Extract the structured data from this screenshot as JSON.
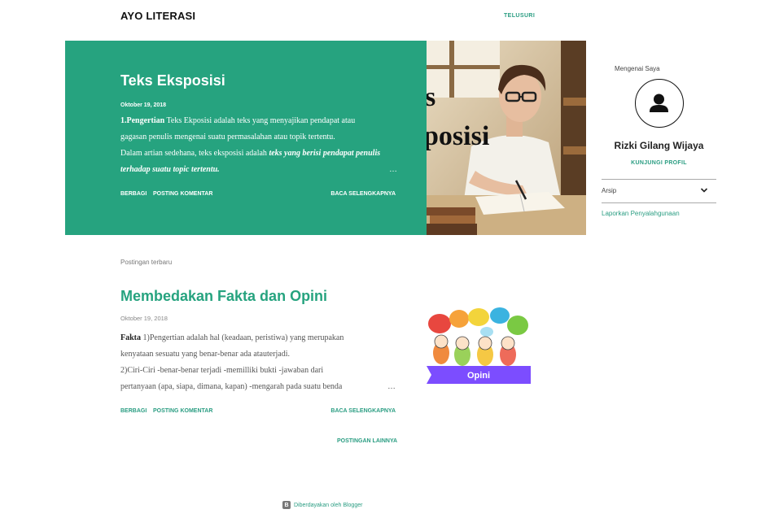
{
  "header": {
    "blog_title": "AYO LITERASI",
    "nav_search": "TELUSURI"
  },
  "featured_post": {
    "title": "Teks Eksposisi",
    "date": "Oktober 19, 2018",
    "snippet_bold_lead": "1.Pengertian",
    "snippet_line1": " Teks Ekposisi adalah teks yang menyajikan pendapat atau",
    "snippet_line2": "gagasan penulis mengenai suatu permasalahan atau topik tertentu.",
    "snippet_line3": "Dalam artian sedehana, teks eksposisi adalah ",
    "snippet_italic": "teks yang berisi pendapat penulis terhadap suatu topic tertentu.",
    "ellipsis": "…",
    "share_label": "BERBAGI",
    "comment_label": "POSTING KOMENTAR",
    "read_more_label": "BACA SELENGKAPNYA",
    "image_overlay_line1": "s",
    "image_overlay_line2": "posisi"
  },
  "recent": {
    "section_label": "Postingan terbaru",
    "post": {
      "title": "Membedakan Fakta dan Opini",
      "date": "Oktober 19, 2018",
      "snippet_bold_lead": "Fakta",
      "snippet_line1": " 1)Pengertian adalah hal (keadaan, peristiwa) yang merupakan",
      "snippet_line2": "kenyataan sesuatu yang benar-benar ada atauterjadi.",
      "snippet_line3": "2)Ciri-Ciri -benar-benar terjadi -memilliki bukti -jawaban dari",
      "snippet_line4": "pertanyaan (apa, siapa, dimana, kapan) -mengarah pada suatu benda",
      "ellipsis": "…",
      "share_label": "BERBAGI",
      "comment_label": "POSTING KOMENTAR",
      "read_more_label": "BACA SELENGKAPNYA",
      "image_banner_text": "Opini"
    },
    "more_posts_label": "POSTINGAN LAINNYA"
  },
  "sidebar": {
    "about_label": "Mengenai Saya",
    "profile_name": "Rizki Gilang Wijaya",
    "profile_link": "KUNJUNGI PROFIL",
    "archive_label": "Arsip",
    "report_link": "Laporkan Penyalahgunaan"
  },
  "footer": {
    "powered_by": "Diberdayakan oleh Blogger"
  },
  "colors": {
    "accent": "#26a37f",
    "link": "#2a9d82",
    "banner_purple": "#7c4dff"
  }
}
